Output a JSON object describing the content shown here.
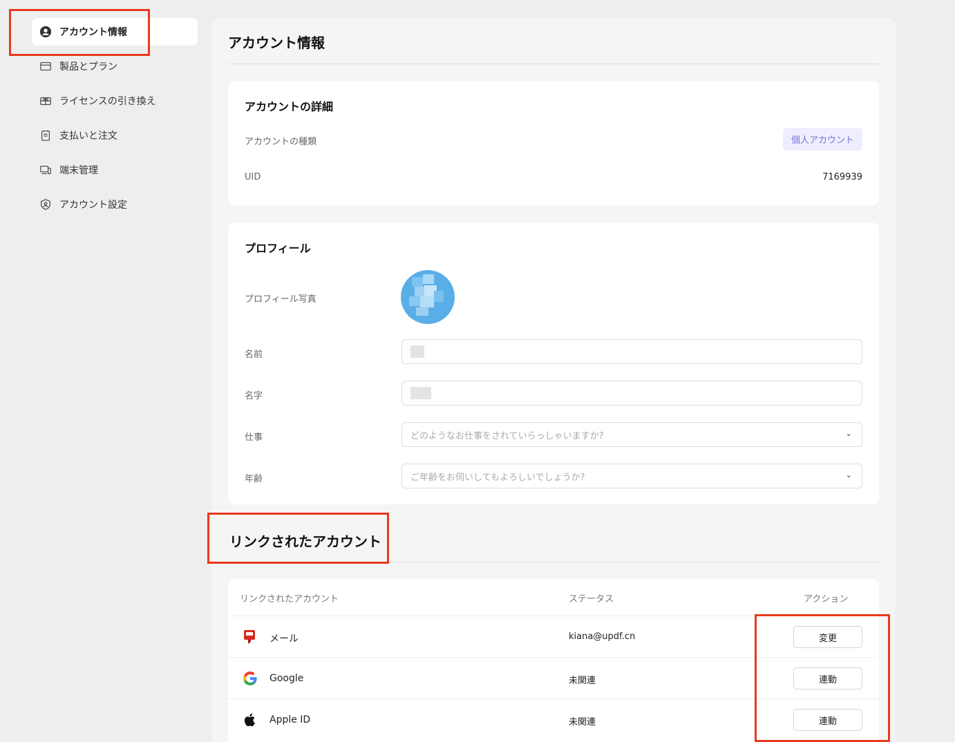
{
  "sidebar": {
    "items": [
      {
        "label": "アカウント情報",
        "icon": "user-circle-icon",
        "active": true
      },
      {
        "label": "製品とプラン",
        "icon": "card-icon"
      },
      {
        "label": "ライセンスの引き換え",
        "icon": "gift-icon"
      },
      {
        "label": "支払いと注文",
        "icon": "receipt-icon"
      },
      {
        "label": "端末管理",
        "icon": "devices-icon"
      },
      {
        "label": "アカウント設定",
        "icon": "shield-user-icon"
      }
    ]
  },
  "main": {
    "title": "アカウント情報",
    "details": {
      "title": "アカウントの詳細",
      "type_label": "アカウントの種類",
      "type_value": "個人アカウント",
      "uid_label": "UID",
      "uid_value": "7169939"
    },
    "profile": {
      "title": "プロフィール",
      "photo_label": "プロフィール写真",
      "first_name_label": "名前",
      "last_name_label": "名字",
      "job_label": "仕事",
      "job_placeholder": "どのようなお仕事をされていらっしゃいますか?",
      "age_label": "年齢",
      "age_placeholder": "ご年齢をお伺いしてもよろしいでしょうか?"
    },
    "linked": {
      "title": "リンクされたアカウント",
      "headers": {
        "account": "リンクされたアカウント",
        "status": "ステータス",
        "action": "アクション"
      },
      "rows": [
        {
          "name": "メール",
          "icon": "mail-icon",
          "status": "kiana@updf.cn",
          "action": "変更"
        },
        {
          "name": "Google",
          "icon": "google-icon",
          "status": "未関連",
          "action": "連動"
        },
        {
          "name": "Apple ID",
          "icon": "apple-icon",
          "status": "未関連",
          "action": "連動"
        }
      ]
    }
  },
  "colors": {
    "highlight": "#e8391c",
    "badge_text": "#7a72d8",
    "badge_bg": "#efeefe"
  }
}
